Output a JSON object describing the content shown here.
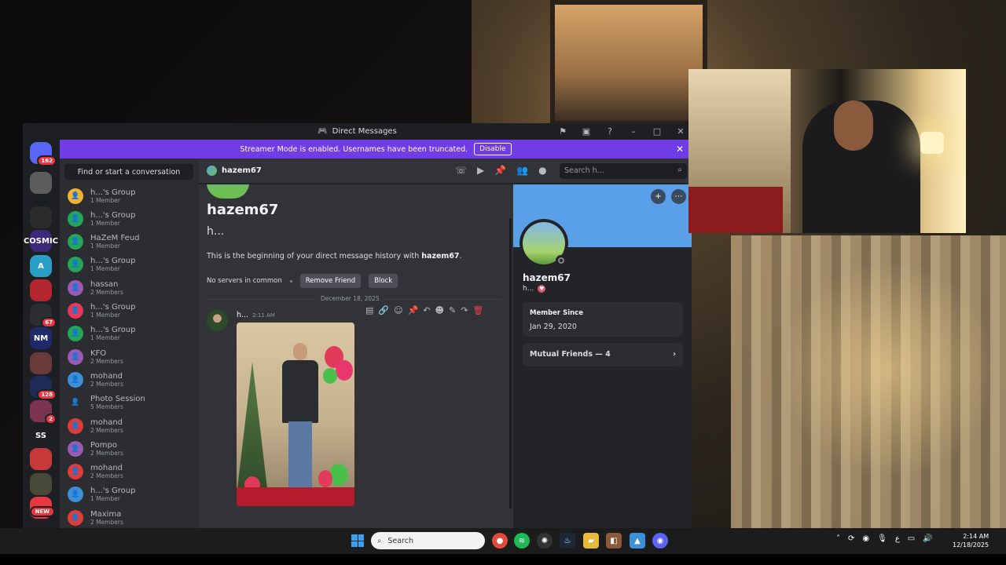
{
  "window": {
    "title": "Direct Messages"
  },
  "banner": {
    "text": "Streamer Mode is enabled. Usernames have been truncated.",
    "button": "Disable"
  },
  "rail": {
    "servers": [
      {
        "name": "discord-home",
        "badge": "162",
        "color": "#5865f2"
      },
      {
        "name": "server-skull",
        "badge": "",
        "color": "#5c5c5c"
      },
      {
        "name": "server-dark",
        "badge": "",
        "color": "#2a2a2a"
      },
      {
        "name": "server-cosmic",
        "badge": "",
        "label": "COSMIC",
        "color": "#3b2a7a"
      },
      {
        "name": "server-a",
        "badge": "",
        "label": "A",
        "color": "#2aa0c8"
      },
      {
        "name": "server-red",
        "badge": "",
        "color": "#b3262e"
      },
      {
        "name": "server-67",
        "badge": "67",
        "color": "#2b2d31"
      },
      {
        "name": "server-nm",
        "badge": "",
        "label": "NM",
        "color": "#1e2a6a"
      },
      {
        "name": "server-portrait",
        "badge": "",
        "color": "#6b3a3a"
      },
      {
        "name": "server-128",
        "badge": "128",
        "color": "#1f2b57"
      },
      {
        "name": "server-pink",
        "badge": "2",
        "color": "#7a3450"
      },
      {
        "name": "server-ss",
        "badge": "",
        "label": "SS",
        "color": "#1e1f22"
      },
      {
        "name": "server-robot",
        "badge": "",
        "color": "#c83a3a"
      },
      {
        "name": "server-soldier",
        "badge": "",
        "color": "#4a4a3a"
      },
      {
        "name": "server-new",
        "badge": "NEW",
        "color": "#e8373f"
      }
    ]
  },
  "dm": {
    "search_placeholder": "Find or start a conversation",
    "items": [
      {
        "name": "h...'s Group",
        "sub": "1 Member",
        "color": "#f0b232"
      },
      {
        "name": "h...'s Group",
        "sub": "1 Member",
        "color": "#23a55a"
      },
      {
        "name": "HaZeM Feud",
        "sub": "1 Member",
        "color": "#23a55a"
      },
      {
        "name": "h...'s Group",
        "sub": "1 Member",
        "color": "#23a55a"
      },
      {
        "name": "hassan",
        "sub": "2 Members",
        "color": "#9b59b6"
      },
      {
        "name": "h...'s Group",
        "sub": "1 Member",
        "color": "#e8375a"
      },
      {
        "name": "h...'s Group",
        "sub": "1 Member",
        "color": "#23a55a"
      },
      {
        "name": "KFO",
        "sub": "2 Members",
        "color": "#9b59b6"
      },
      {
        "name": "mohand",
        "sub": "2 Members",
        "color": "#3c8fd8"
      },
      {
        "name": "Photo Session",
        "sub": "5 Members",
        "color": "#2b2d31"
      },
      {
        "name": "mohand",
        "sub": "2 Members",
        "color": "#e03b3b"
      },
      {
        "name": "Pompo",
        "sub": "2 Members",
        "color": "#9b59b6"
      },
      {
        "name": "mohand",
        "sub": "2 Members",
        "color": "#e03b3b"
      },
      {
        "name": "h...'s Group",
        "sub": "1 Member",
        "color": "#3c8fd8"
      },
      {
        "name": "Maxima",
        "sub": "2 Members",
        "color": "#e03b3b"
      }
    ]
  },
  "chat": {
    "header_user": "hazem67",
    "search_placeholder": "Search h...",
    "intro_name": "hazem67",
    "intro_tag": "h...",
    "intro_prefix": "This is the beginning of your direct message history with ",
    "intro_user": "hazem67",
    "intro_suffix": ".",
    "no_servers": "No servers in common",
    "remove_friend": "Remove Friend",
    "block": "Block",
    "date_divider": "December 18, 2025",
    "message_author": "h...",
    "message_time": "2:11 AM"
  },
  "profile": {
    "name": "hazem67",
    "tag": "h...",
    "member_since_label": "Member Since",
    "member_since_value": "Jan 29, 2020",
    "mutual_friends": "Mutual Friends — 4"
  },
  "taskbar": {
    "search": "Search",
    "time": "2:14 AM",
    "date": "12/18/2025"
  }
}
